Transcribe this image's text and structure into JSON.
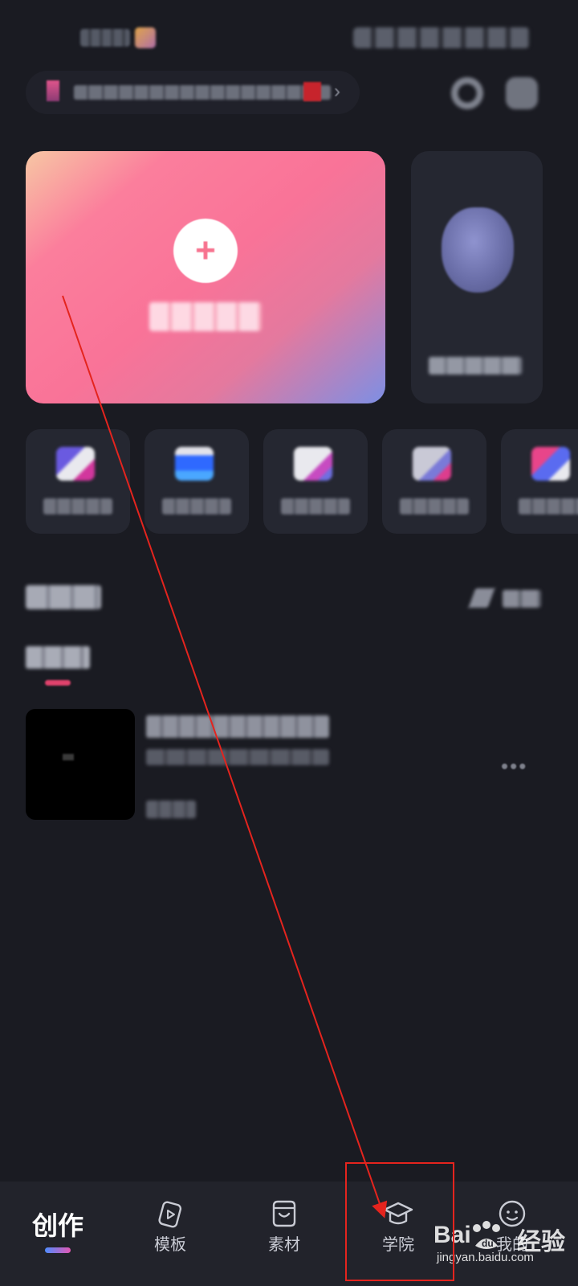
{
  "status_bar": {},
  "header": {},
  "create_card": {},
  "avatar_card": {},
  "tools": [
    {
      "icon_colors": [
        "#6a5ae0",
        "#e9e9ee",
        "#d2379d"
      ]
    },
    {
      "icon_colors": [
        "#4aa7ff",
        "#2f69ff",
        "#e3e3ea"
      ]
    },
    {
      "icon_colors": [
        "#e9e9ee",
        "#c74bc1",
        "#6f6fe0"
      ]
    },
    {
      "icon_colors": [
        "#c9c9d6",
        "#dd3d8d",
        "#7a7ad8"
      ]
    },
    {
      "icon_colors": [
        "#e8458a",
        "#5a6bf0",
        "#e9e9ee"
      ]
    }
  ],
  "drafts_section": {},
  "tab_bar": {
    "tabs": [
      {
        "label": "创作",
        "active": true,
        "icon": "create-icon"
      },
      {
        "label": "模板",
        "active": false,
        "icon": "template-icon"
      },
      {
        "label": "素材",
        "active": false,
        "icon": "material-icon"
      },
      {
        "label": "学院",
        "active": false,
        "icon": "academy-icon"
      },
      {
        "label": "我的",
        "active": false,
        "icon": "profile-icon"
      }
    ]
  },
  "watermark": {
    "brand": "Bai",
    "brand_cn": "经验",
    "url": "jingyan.baidu.com"
  },
  "annotation": {
    "color": "#e4241e"
  }
}
